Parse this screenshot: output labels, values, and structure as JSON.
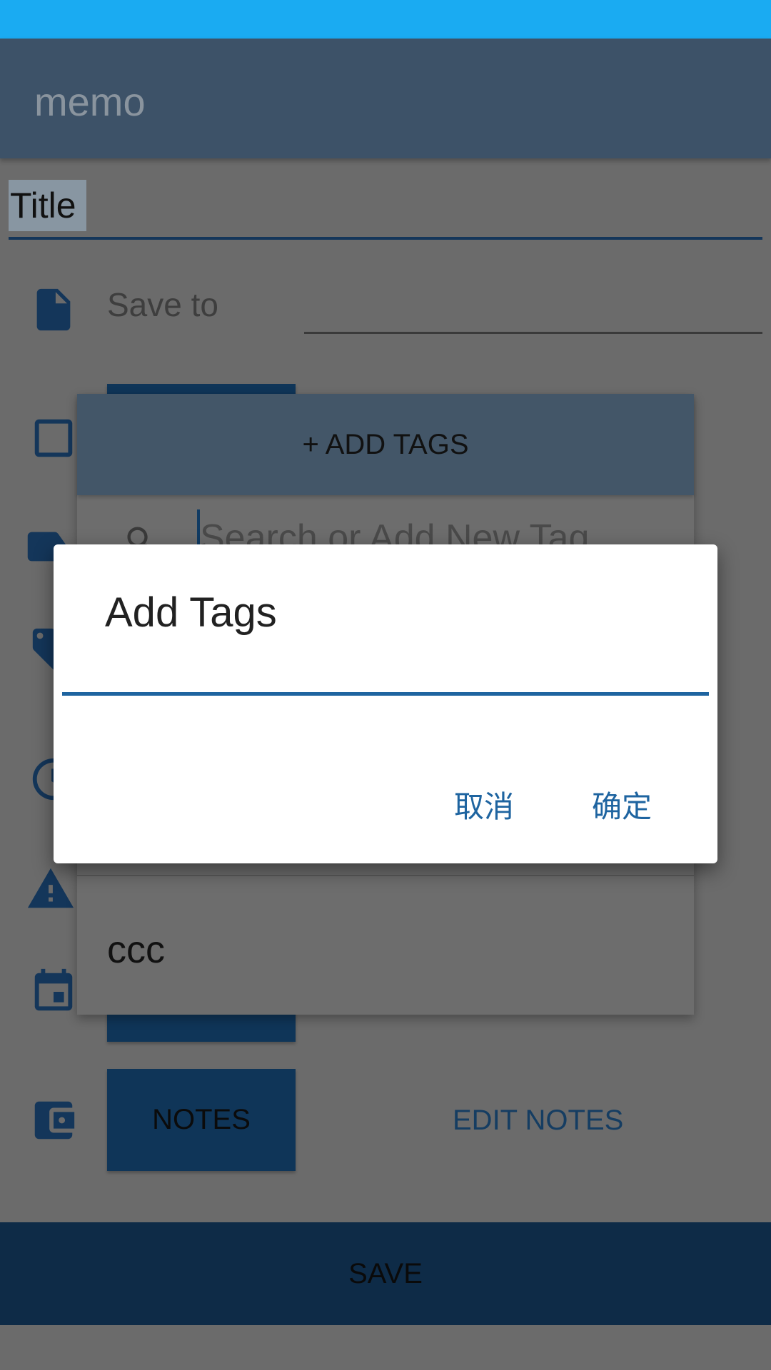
{
  "app": {
    "title": "memo"
  },
  "form": {
    "title_value": "Title",
    "save_to_label": "Save to",
    "notes_label": "NOTES",
    "edit_notes_label": "EDIT NOTES",
    "save_label": "SAVE"
  },
  "tag_popup": {
    "header_label": "+ ADD TAGS",
    "search_placeholder": "Search or Add New Tag",
    "items": [
      "ccc"
    ]
  },
  "dialog": {
    "title": "Add Tags",
    "input_value": "",
    "cancel_label": "取消",
    "ok_label": "确定"
  },
  "colors": {
    "status_bar": "#1aabf2",
    "app_bar": "#3d5268",
    "primary": "#1e64a0",
    "dialog_bg": "#ffffff"
  }
}
